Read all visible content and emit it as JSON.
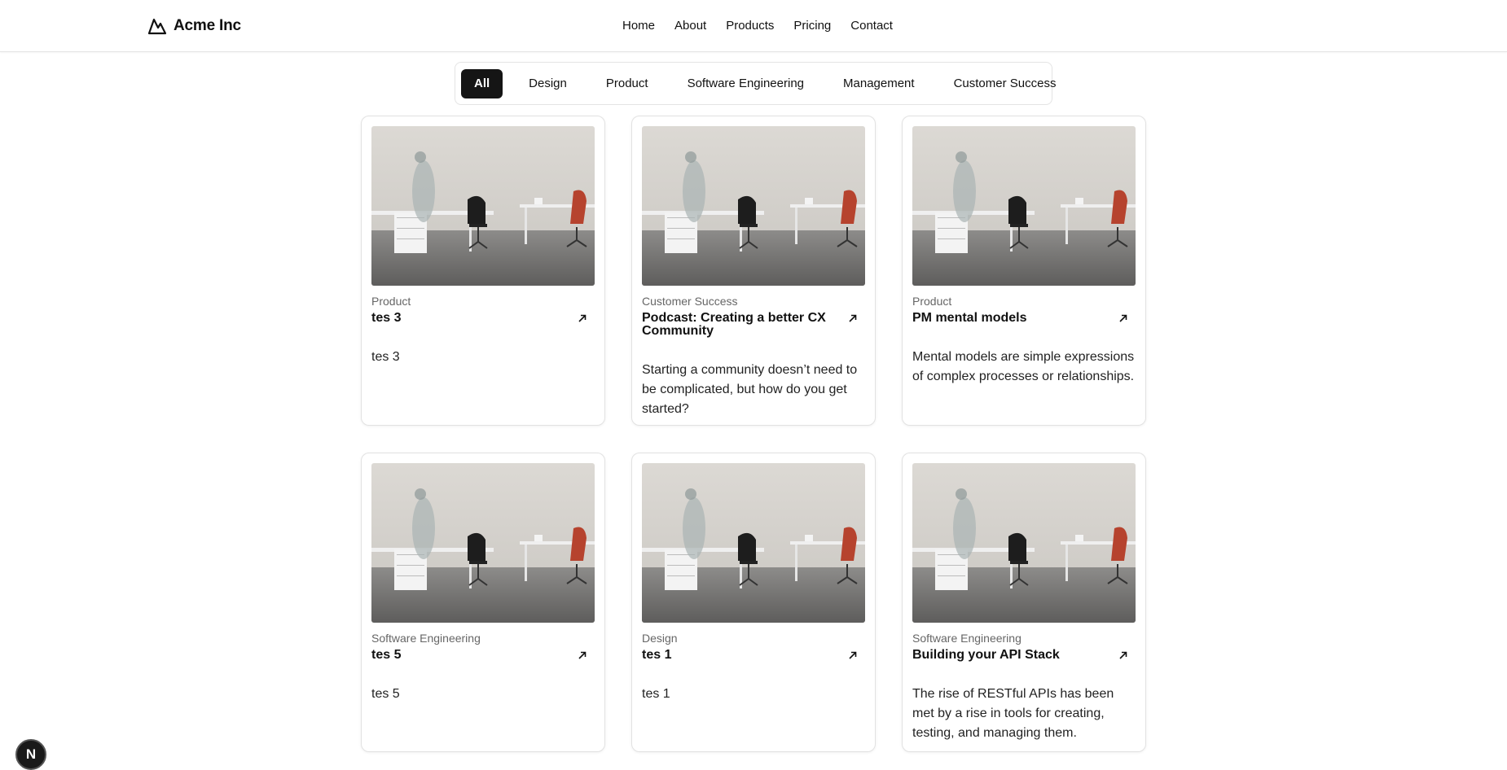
{
  "header": {
    "brand_name": "Acme Inc",
    "nav": [
      {
        "label": "Home"
      },
      {
        "label": "About"
      },
      {
        "label": "Products"
      },
      {
        "label": "Pricing"
      },
      {
        "label": "Contact"
      }
    ]
  },
  "tabs": [
    {
      "label": "All",
      "active": true
    },
    {
      "label": "Design"
    },
    {
      "label": "Product"
    },
    {
      "label": "Software Engineering"
    },
    {
      "label": "Management"
    },
    {
      "label": "Customer Success"
    }
  ],
  "cards": [
    {
      "category": "Product",
      "title": "tes 3",
      "description": "tes 3"
    },
    {
      "category": "Customer Success",
      "title": "Podcast: Creating a better CX Community",
      "description": "Starting a community doesn’t need to be complicated, but how do you get started?"
    },
    {
      "category": "Product",
      "title": "PM mental models",
      "description": "Mental models are simple expressions of complex processes or relationships."
    },
    {
      "category": "Software Engineering",
      "title": "tes 5",
      "description": "tes 5"
    },
    {
      "category": "Design",
      "title": "tes 1",
      "description": "tes 1"
    },
    {
      "category": "Software Engineering",
      "title": "Building your API Stack",
      "description": "The rise of RESTful APIs has been met by a rise in tools for creating, testing, and managing them."
    }
  ],
  "fab": {
    "label": "N"
  },
  "colors": {
    "active_tab_bg": "#151515",
    "border": "#e2e2e2",
    "muted_text": "#666666"
  },
  "icons": {
    "brand": "mountain-logo-icon",
    "card_link": "arrow-up-right-icon"
  }
}
